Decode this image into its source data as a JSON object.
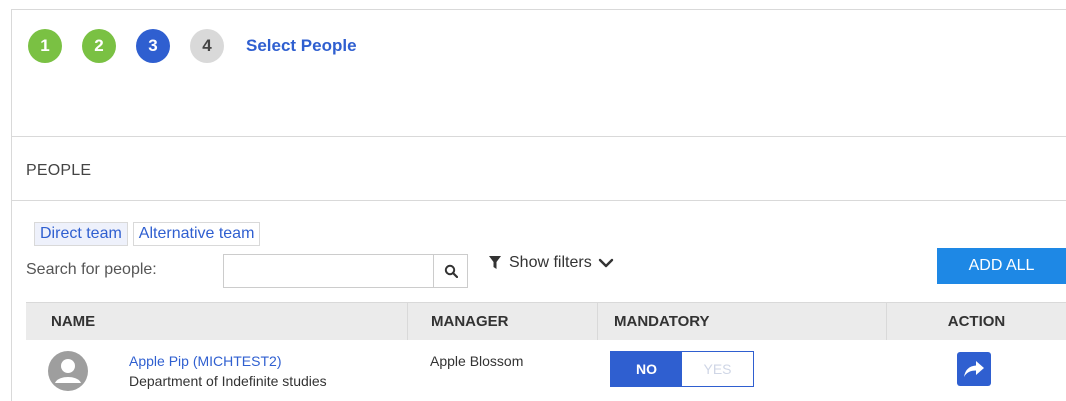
{
  "stepper": {
    "steps": [
      {
        "label": "1",
        "state": "done"
      },
      {
        "label": "2",
        "state": "done"
      },
      {
        "label": "3",
        "state": "active"
      },
      {
        "label": "4",
        "state": "todo"
      }
    ],
    "title": "Select People"
  },
  "section": {
    "title": "PEOPLE"
  },
  "tabs": [
    {
      "label": "Direct team",
      "selected": true
    },
    {
      "label": "Alternative team",
      "selected": false
    }
  ],
  "search": {
    "label": "Search for people:",
    "value": "",
    "placeholder": ""
  },
  "filters": {
    "label": "Show filters"
  },
  "add_all": {
    "label": "ADD ALL"
  },
  "table": {
    "columns": [
      "NAME",
      "MANAGER",
      "MANDATORY",
      "ACTION"
    ],
    "rows": [
      {
        "name": "Apple Pip (MICHTEST2)",
        "department": "Department of Indefinite studies",
        "manager": "Apple Blossom",
        "mandatory_options": [
          "NO",
          "YES"
        ],
        "mandatory_selected": "NO",
        "action_icon": "share-arrow-icon"
      }
    ]
  },
  "colors": {
    "step_done": "#7ac143",
    "step_active": "#2f5fd0",
    "step_todo": "#d9d9d9",
    "link": "#2f5fd0",
    "primary_button": "#1e88e5"
  }
}
